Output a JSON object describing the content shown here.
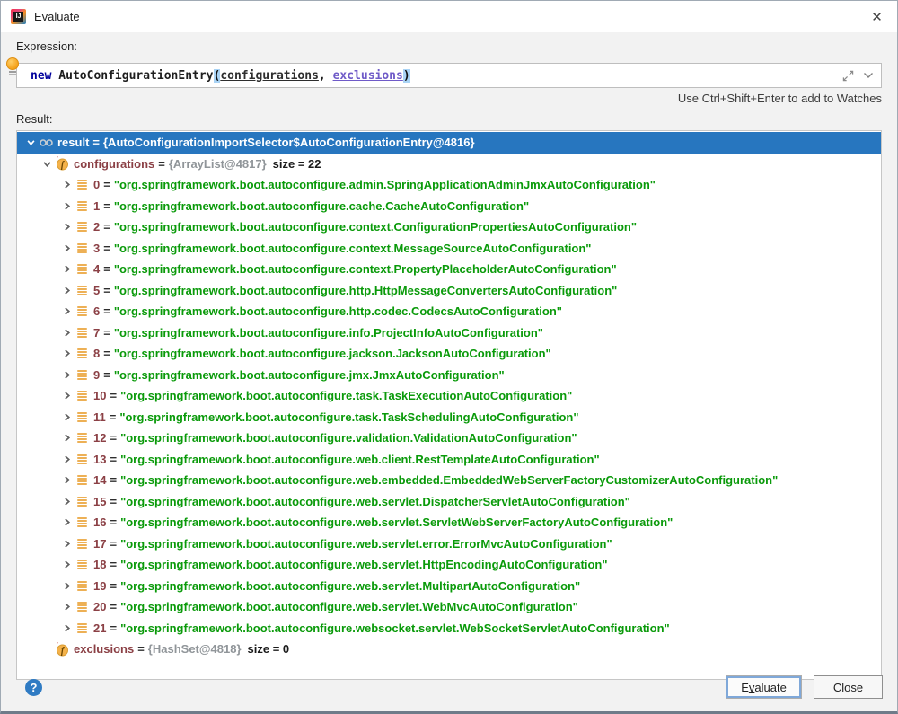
{
  "window": {
    "title": "Evaluate",
    "close_glyph": "✕"
  },
  "colors": {
    "selection_blue": "#2776BF",
    "string_green": "#0A9A0A",
    "name_maroon": "#8B4045",
    "type_gray": "#909599",
    "keyword_navy": "#00009C",
    "param_purple": "#6F5BC8"
  },
  "expression": {
    "label": "Expression:",
    "code": {
      "keyword": "new",
      "callee": " AutoConfigurationEntry",
      "open_paren": "(",
      "arg1": "configurations",
      "comma": ", ",
      "arg2": "exclusions",
      "close_paren": ")"
    },
    "hint": "Use Ctrl+Shift+Enter to add to Watches"
  },
  "result": {
    "label": "Result:",
    "eq": "=",
    "root": {
      "name": "result",
      "value": "{AutoConfigurationImportSelector$AutoConfigurationEntry@4816}"
    },
    "configurations": {
      "name": "configurations",
      "value": "{ArrayList@4817}",
      "size_text": "size = 22"
    },
    "items": [
      {
        "index": "0",
        "value": "\"org.springframework.boot.autoconfigure.admin.SpringApplicationAdminJmxAutoConfiguration\""
      },
      {
        "index": "1",
        "value": "\"org.springframework.boot.autoconfigure.cache.CacheAutoConfiguration\""
      },
      {
        "index": "2",
        "value": "\"org.springframework.boot.autoconfigure.context.ConfigurationPropertiesAutoConfiguration\""
      },
      {
        "index": "3",
        "value": "\"org.springframework.boot.autoconfigure.context.MessageSourceAutoConfiguration\""
      },
      {
        "index": "4",
        "value": "\"org.springframework.boot.autoconfigure.context.PropertyPlaceholderAutoConfiguration\""
      },
      {
        "index": "5",
        "value": "\"org.springframework.boot.autoconfigure.http.HttpMessageConvertersAutoConfiguration\""
      },
      {
        "index": "6",
        "value": "\"org.springframework.boot.autoconfigure.http.codec.CodecsAutoConfiguration\""
      },
      {
        "index": "7",
        "value": "\"org.springframework.boot.autoconfigure.info.ProjectInfoAutoConfiguration\""
      },
      {
        "index": "8",
        "value": "\"org.springframework.boot.autoconfigure.jackson.JacksonAutoConfiguration\""
      },
      {
        "index": "9",
        "value": "\"org.springframework.boot.autoconfigure.jmx.JmxAutoConfiguration\""
      },
      {
        "index": "10",
        "value": "\"org.springframework.boot.autoconfigure.task.TaskExecutionAutoConfiguration\""
      },
      {
        "index": "11",
        "value": "\"org.springframework.boot.autoconfigure.task.TaskSchedulingAutoConfiguration\""
      },
      {
        "index": "12",
        "value": "\"org.springframework.boot.autoconfigure.validation.ValidationAutoConfiguration\""
      },
      {
        "index": "13",
        "value": "\"org.springframework.boot.autoconfigure.web.client.RestTemplateAutoConfiguration\""
      },
      {
        "index": "14",
        "value": "\"org.springframework.boot.autoconfigure.web.embedded.EmbeddedWebServerFactoryCustomizerAutoConfiguration\""
      },
      {
        "index": "15",
        "value": "\"org.springframework.boot.autoconfigure.web.servlet.DispatcherServletAutoConfiguration\""
      },
      {
        "index": "16",
        "value": "\"org.springframework.boot.autoconfigure.web.servlet.ServletWebServerFactoryAutoConfiguration\""
      },
      {
        "index": "17",
        "value": "\"org.springframework.boot.autoconfigure.web.servlet.error.ErrorMvcAutoConfiguration\""
      },
      {
        "index": "18",
        "value": "\"org.springframework.boot.autoconfigure.web.servlet.HttpEncodingAutoConfiguration\""
      },
      {
        "index": "19",
        "value": "\"org.springframework.boot.autoconfigure.web.servlet.MultipartAutoConfiguration\""
      },
      {
        "index": "20",
        "value": "\"org.springframework.boot.autoconfigure.web.servlet.WebMvcAutoConfiguration\""
      },
      {
        "index": "21",
        "value": "\"org.springframework.boot.autoconfigure.websocket.servlet.WebSocketServletAutoConfiguration\""
      }
    ],
    "exclusions": {
      "name": "exclusions",
      "value": "{HashSet@4818}",
      "size_text": "size = 0"
    }
  },
  "footer": {
    "help_glyph": "?",
    "evaluate": {
      "pre": "E",
      "mnemonic": "v",
      "post": "aluate"
    },
    "close_label": "Close"
  }
}
